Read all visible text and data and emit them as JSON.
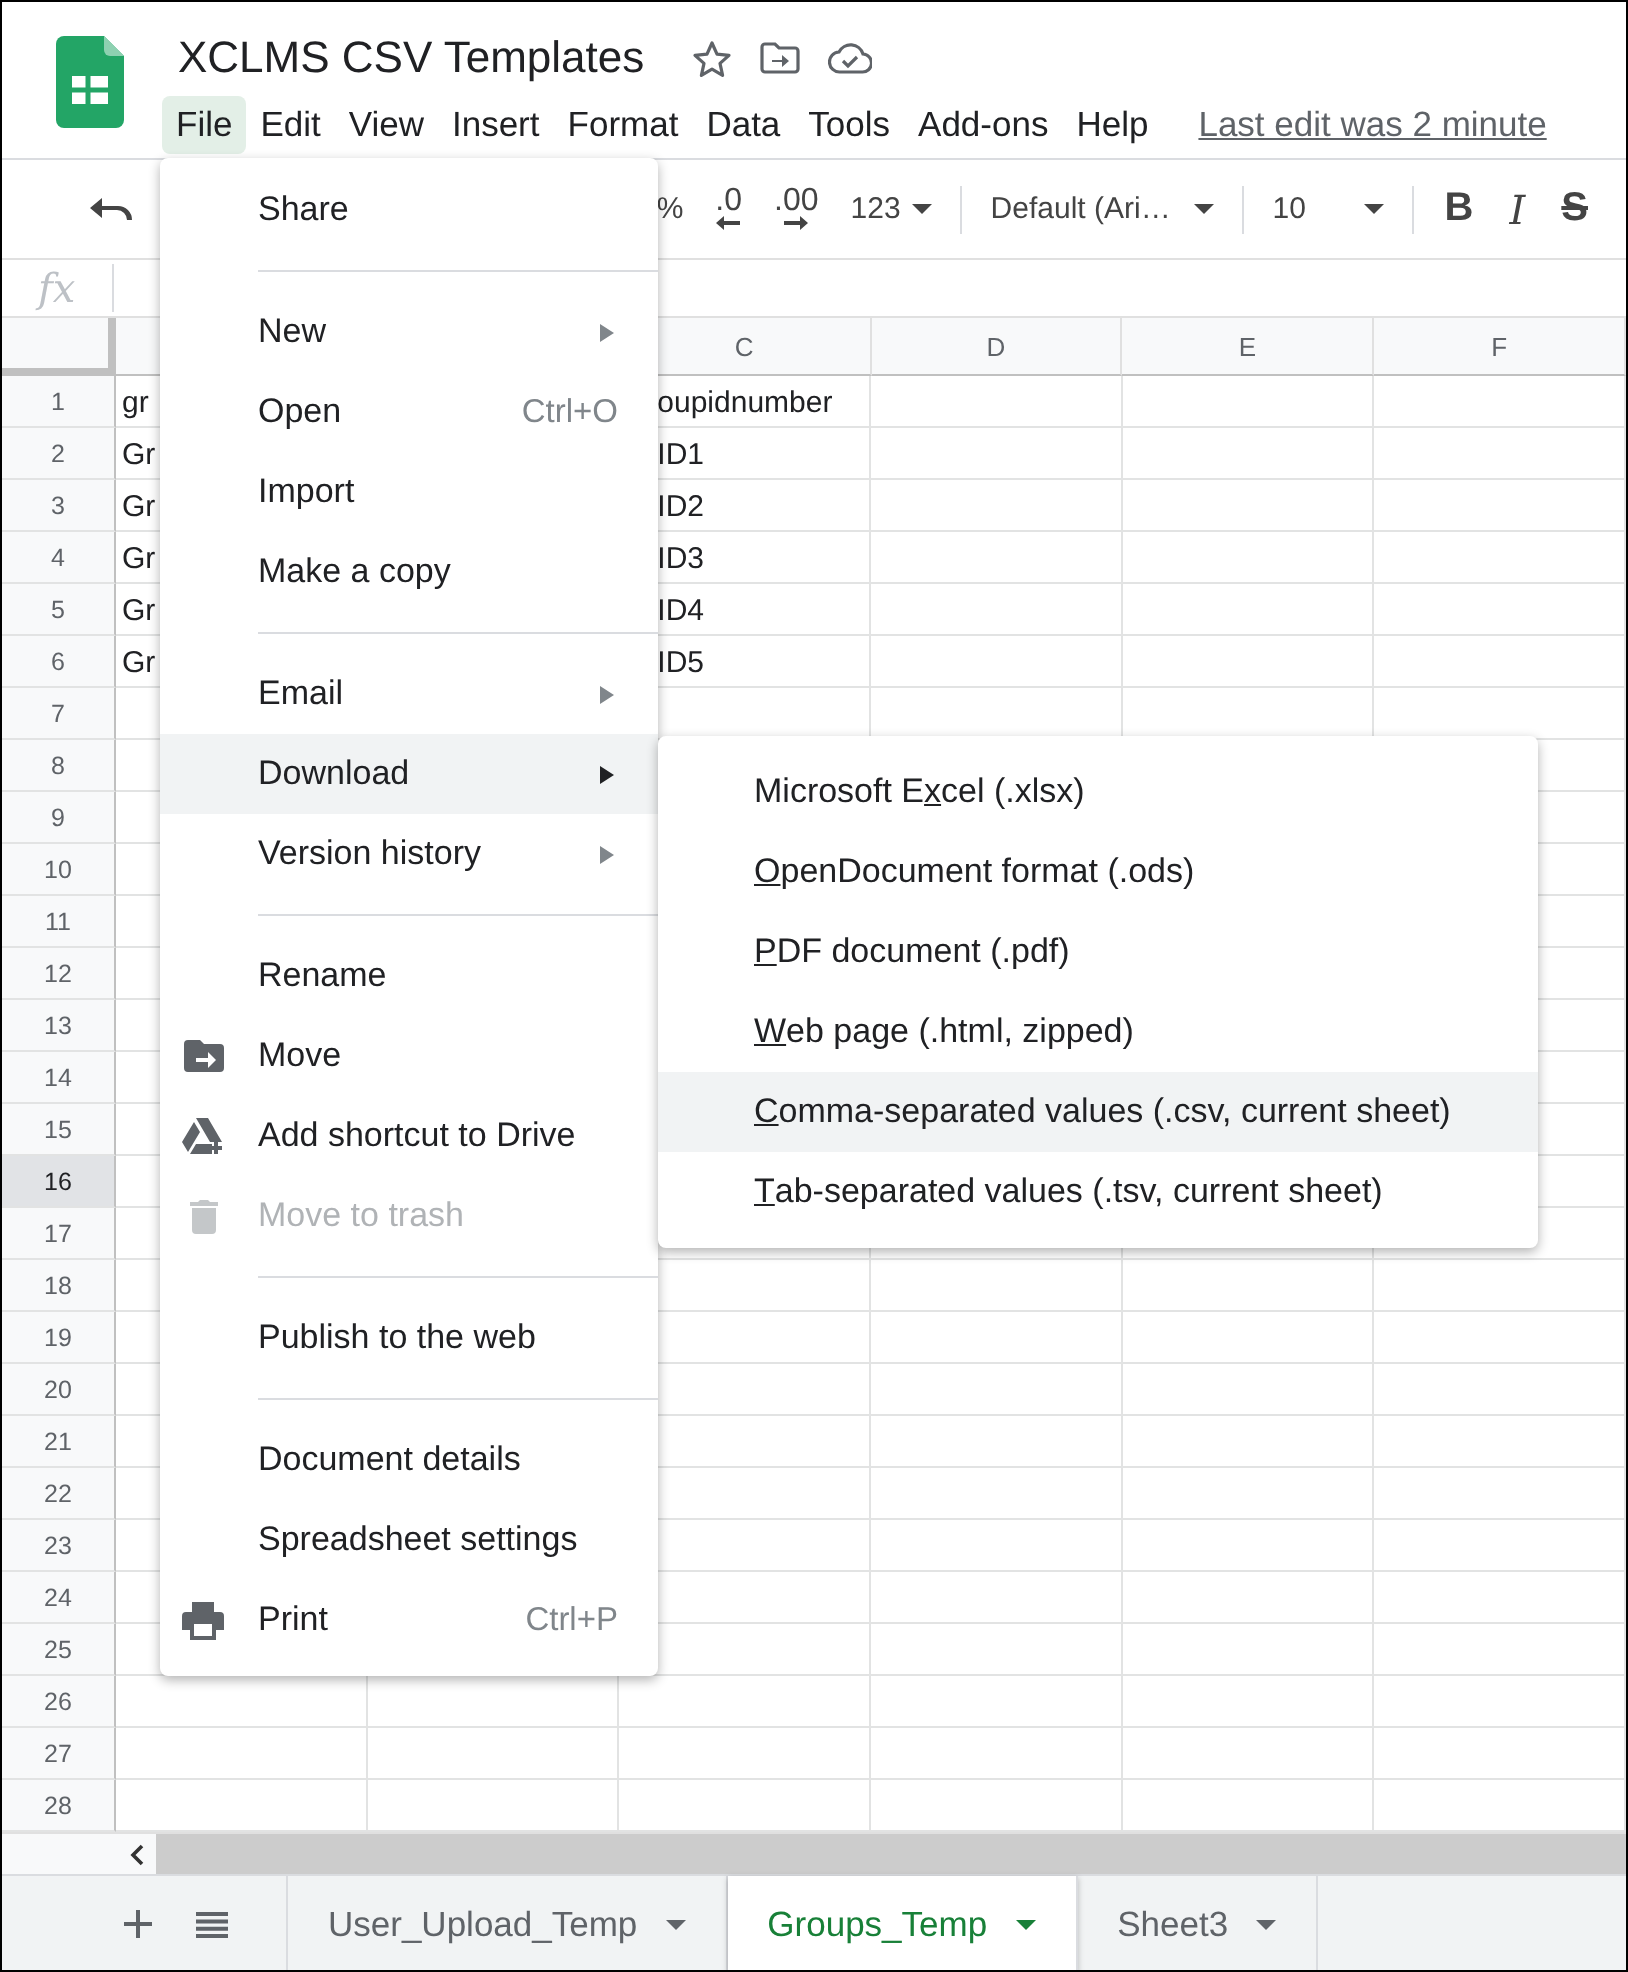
{
  "title": "XCLMS CSV Templates",
  "menubar": [
    {
      "label": "File",
      "selected": true
    },
    {
      "label": "Edit",
      "selected": false
    },
    {
      "label": "View",
      "selected": false
    },
    {
      "label": "Insert",
      "selected": false
    },
    {
      "label": "Format",
      "selected": false
    },
    {
      "label": "Data",
      "selected": false
    },
    {
      "label": "Tools",
      "selected": false
    },
    {
      "label": "Add-ons",
      "selected": false
    },
    {
      "label": "Help",
      "selected": false
    }
  ],
  "last_edit": "Last edit was 2 minute",
  "toolbar": {
    "percent": "%",
    "decrease_decimals": ".0",
    "increase_decimals": ".00",
    "number_format": "123",
    "font": "Default (Ari…",
    "font_size": "10",
    "bold": "B",
    "italic": "I",
    "strikethrough": "S"
  },
  "formula_bar": {
    "label": "fx"
  },
  "grid": {
    "columns": [
      "C",
      "D",
      "E",
      "F"
    ],
    "rows": [
      {
        "number": "1",
        "selected": false,
        "a": "gr",
        "c": "oupidnumber"
      },
      {
        "number": "2",
        "selected": false,
        "a": "Gr",
        "c": "ID1"
      },
      {
        "number": "3",
        "selected": false,
        "a": "Gr",
        "c": "ID2"
      },
      {
        "number": "4",
        "selected": false,
        "a": "Gr",
        "c": "ID3"
      },
      {
        "number": "5",
        "selected": false,
        "a": "Gr",
        "c": "ID4"
      },
      {
        "number": "6",
        "selected": false,
        "a": "Gr",
        "c": "ID5"
      },
      {
        "number": "7",
        "selected": false
      },
      {
        "number": "8",
        "selected": false
      },
      {
        "number": "9",
        "selected": false
      },
      {
        "number": "10",
        "selected": false
      },
      {
        "number": "11",
        "selected": false
      },
      {
        "number": "12",
        "selected": false
      },
      {
        "number": "13",
        "selected": false
      },
      {
        "number": "14",
        "selected": false
      },
      {
        "number": "15",
        "selected": false
      },
      {
        "number": "16",
        "selected": true
      },
      {
        "number": "17",
        "selected": false
      },
      {
        "number": "18",
        "selected": false
      },
      {
        "number": "19",
        "selected": false
      },
      {
        "number": "20",
        "selected": false
      },
      {
        "number": "21",
        "selected": false
      },
      {
        "number": "22",
        "selected": false
      },
      {
        "number": "23",
        "selected": false
      },
      {
        "number": "24",
        "selected": false
      },
      {
        "number": "25",
        "selected": false
      },
      {
        "number": "26",
        "selected": false
      },
      {
        "number": "27",
        "selected": false
      },
      {
        "number": "28",
        "selected": false
      }
    ]
  },
  "file_menu": [
    {
      "kind": "item",
      "label": "Share",
      "selected": false,
      "disabled": false,
      "submenu": false
    },
    {
      "kind": "divider"
    },
    {
      "kind": "item",
      "label": "New",
      "selected": false,
      "disabled": false,
      "submenu": true
    },
    {
      "kind": "item",
      "label": "Open",
      "shortcut": "Ctrl+O",
      "selected": false,
      "disabled": false,
      "submenu": false
    },
    {
      "kind": "item",
      "label": "Import",
      "selected": false,
      "disabled": false,
      "submenu": false
    },
    {
      "kind": "item",
      "label": "Make a copy",
      "selected": false,
      "disabled": false,
      "submenu": false
    },
    {
      "kind": "divider"
    },
    {
      "kind": "item",
      "label": "Email",
      "selected": false,
      "disabled": false,
      "submenu": true
    },
    {
      "kind": "item",
      "label": "Download",
      "selected": true,
      "disabled": false,
      "submenu": true
    },
    {
      "kind": "item",
      "label": "Version history",
      "selected": false,
      "disabled": false,
      "submenu": true
    },
    {
      "kind": "divider"
    },
    {
      "kind": "item",
      "label": "Rename",
      "selected": false,
      "disabled": false,
      "submenu": false
    },
    {
      "kind": "move",
      "label": "Move",
      "selected": false,
      "disabled": false,
      "submenu": false
    },
    {
      "kind": "shortcut",
      "label": "Add shortcut to Drive",
      "selected": false,
      "disabled": false,
      "submenu": false
    },
    {
      "kind": "trash",
      "label": "Move to trash",
      "selected": false,
      "disabled": true,
      "submenu": false
    },
    {
      "kind": "divider"
    },
    {
      "kind": "item",
      "label": "Publish to the web",
      "selected": false,
      "disabled": false,
      "submenu": false
    },
    {
      "kind": "divider"
    },
    {
      "kind": "item",
      "label": "Document details",
      "selected": false,
      "disabled": false,
      "submenu": false
    },
    {
      "kind": "item",
      "label": "Spreadsheet settings",
      "selected": false,
      "disabled": false,
      "submenu": false
    },
    {
      "kind": "print",
      "label": "Print",
      "shortcut": "Ctrl+P",
      "selected": false,
      "disabled": false,
      "submenu": false
    }
  ],
  "download_menu": [
    {
      "pre": "Microsoft E",
      "key": "x",
      "post": "cel (.xlsx)",
      "selected": false
    },
    {
      "key": "O",
      "post": "penDocument format (.ods)",
      "selected": false
    },
    {
      "key": "P",
      "post": "DF document (.pdf)",
      "selected": false
    },
    {
      "key": "W",
      "post": "eb page (.html, zipped)",
      "selected": false
    },
    {
      "key": "C",
      "post": "omma-separated values (.csv, current sheet)",
      "selected": true
    },
    {
      "key": "T",
      "post": "ab-separated values (.tsv, current sheet)",
      "selected": false
    }
  ],
  "sheet_tabs": [
    {
      "label": "User_Upload_Temp",
      "selected": false
    },
    {
      "label": "Groups_Temp",
      "selected": true
    },
    {
      "label": "Sheet3",
      "selected": false
    }
  ]
}
